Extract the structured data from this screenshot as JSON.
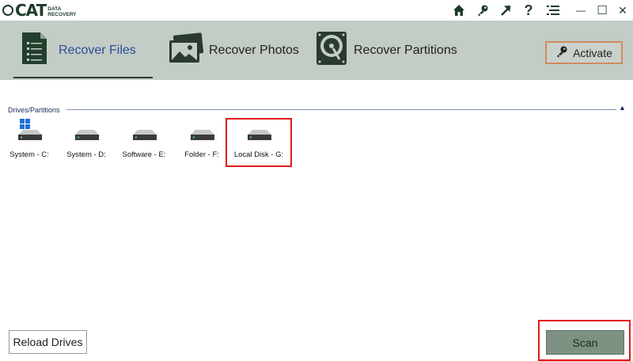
{
  "app": {
    "logo_main": "CAT",
    "logo_sub_1": "DATA",
    "logo_sub_2": "RECOVERY",
    "accent_color": "#2a4d9a",
    "highlight_color": "#e01b1b"
  },
  "titlebar": {
    "icons": [
      "home-icon",
      "key-icon",
      "arrow-up-right-icon",
      "help-icon",
      "menu-icon"
    ],
    "help_glyph": "?",
    "minimize_glyph": "—",
    "maximize_glyph": "☐",
    "close_glyph": "✕"
  },
  "tabs": [
    {
      "label": "Recover Files",
      "icon": "document-icon",
      "active": true
    },
    {
      "label": "Recover Photos",
      "icon": "photos-icon",
      "active": false
    },
    {
      "label": "Recover Partitions",
      "icon": "hard-disk-icon",
      "active": false
    }
  ],
  "activate": {
    "label": "Activate"
  },
  "drives_section": {
    "title": "Drives/Partitions",
    "collapse_glyph": "▲",
    "drives": [
      {
        "label": "System - C:",
        "windows": true,
        "selected": false
      },
      {
        "label": "System - D:",
        "windows": false,
        "selected": false
      },
      {
        "label": "Software - E:",
        "windows": false,
        "selected": false
      },
      {
        "label": "Folder - F:",
        "windows": false,
        "selected": false
      },
      {
        "label": "Local Disk - G:",
        "windows": false,
        "selected": true
      }
    ]
  },
  "footer": {
    "reload_label": "Reload Drives",
    "scan_label": "Scan"
  }
}
